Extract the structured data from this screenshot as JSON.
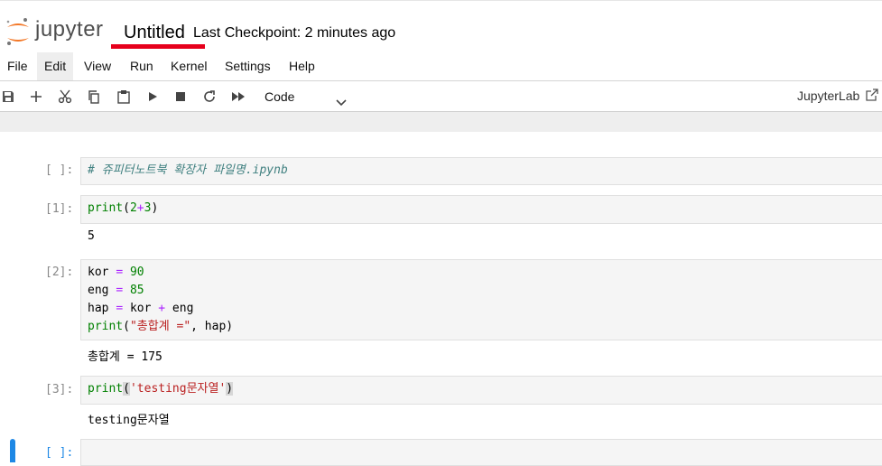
{
  "header": {
    "logo_text": "jupyter",
    "notebook_title": "Untitled",
    "checkpoint": "Last Checkpoint: 2 minutes ago"
  },
  "menubar": {
    "items": [
      "File",
      "Edit",
      "View",
      "Run",
      "Kernel",
      "Settings",
      "Help"
    ],
    "active": "Edit"
  },
  "toolbar": {
    "icons": [
      "save-icon",
      "add-icon",
      "cut-icon",
      "copy-icon",
      "paste-icon",
      "run-icon",
      "stop-icon",
      "restart-icon",
      "fast-forward-icon"
    ],
    "cell_type": "Code",
    "jupyterlab_link": "JupyterLab"
  },
  "cells": [
    {
      "prompt": "[ ]:",
      "code": "# 쥬피터노트북 확장자 파일명.ipynb",
      "output": ""
    },
    {
      "prompt": "[1]:",
      "code": "print(2+3)",
      "output": "5"
    },
    {
      "prompt": "[2]:",
      "code_lines": [
        "kor = 90",
        "eng = 85",
        "hap = kor + eng",
        "print(\"총합계 =\", hap)"
      ],
      "output": "총합계 = 175"
    },
    {
      "prompt": "[3]:",
      "code": "print('testing문자열')",
      "output": "testing문자열"
    },
    {
      "prompt": "[ ]:",
      "code": "",
      "output": ""
    }
  ],
  "colors": {
    "accent_underline": "#e6001c",
    "active_cell_bar": "#1e88e5",
    "keyword": "#008000",
    "string": "#ba2121",
    "comment": "#408080",
    "operator": "#aa22ff"
  }
}
